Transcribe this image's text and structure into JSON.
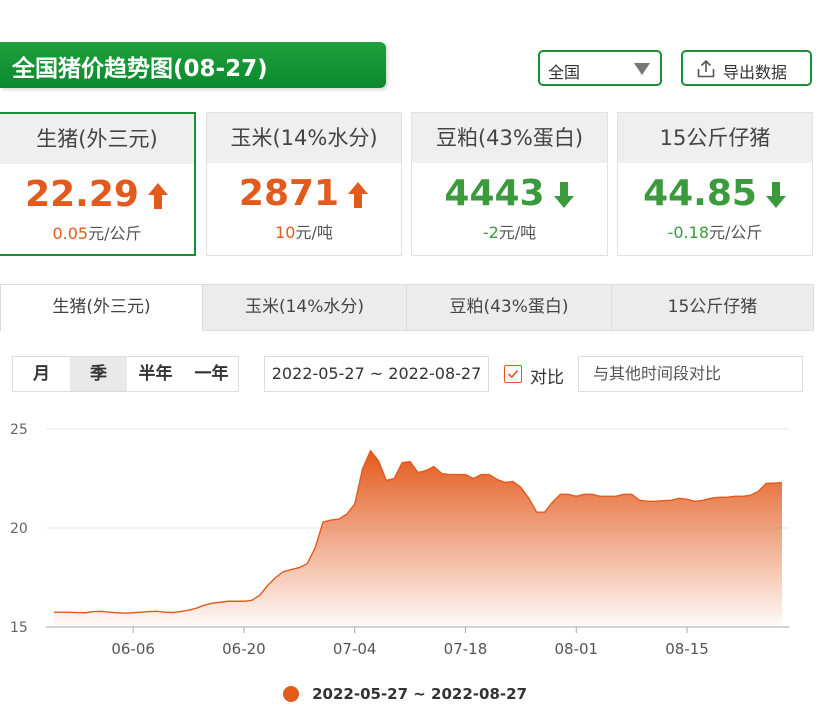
{
  "header": {
    "title": "全国猪价趋势图(08-27)",
    "region": "全国",
    "export_label": "导出数据"
  },
  "cards": [
    {
      "name": "生猪(外三元)",
      "price": "22.29",
      "change_value": "0.05",
      "change_unit": "元/公斤",
      "direction": "up"
    },
    {
      "name": "玉米(14%水分)",
      "price": "2871",
      "change_value": "10",
      "change_unit": "元/吨",
      "direction": "up"
    },
    {
      "name": "豆粕(43%蛋白)",
      "price": "4443",
      "change_value": "-2",
      "change_unit": "元/吨",
      "direction": "down"
    },
    {
      "name": "15公斤仔猪",
      "price": "44.85",
      "change_value": "-0.18",
      "change_unit": "元/公斤",
      "direction": "down"
    }
  ],
  "tabs": [
    "生猪(外三元)",
    "玉米(14%水分)",
    "豆粕(43%蛋白)",
    "15公斤仔猪"
  ],
  "ranges": [
    "月",
    "季",
    "半年",
    "一年"
  ],
  "date_range": "2022-05-27 ~ 2022-08-27",
  "compare": {
    "label": "对比",
    "placeholder": "与其他时间段对比"
  },
  "colors": {
    "brand_green": "#1b8f36",
    "up": "#e35a1d",
    "down": "#3a9a3c",
    "series": "#e35a1d"
  },
  "chart_data": {
    "type": "area",
    "title": "",
    "xlabel": "",
    "ylabel": "",
    "ylim": [
      15,
      25
    ],
    "yticks": [
      15,
      20,
      25
    ],
    "xtick_labels": [
      "06-06",
      "06-20",
      "07-04",
      "07-18",
      "08-01",
      "08-15"
    ],
    "grid": "horizontal",
    "legend_position": "bottom-center",
    "series": [
      {
        "name": "2022-05-27 ~ 2022-08-27",
        "x": [
          "05-27",
          "05-28",
          "05-29",
          "05-30",
          "05-31",
          "06-01",
          "06-02",
          "06-03",
          "06-04",
          "06-05",
          "06-06",
          "06-07",
          "06-08",
          "06-09",
          "06-10",
          "06-11",
          "06-12",
          "06-13",
          "06-14",
          "06-15",
          "06-16",
          "06-17",
          "06-18",
          "06-19",
          "06-20",
          "06-21",
          "06-22",
          "06-23",
          "06-24",
          "06-25",
          "06-26",
          "06-27",
          "06-28",
          "06-29",
          "06-30",
          "07-01",
          "07-02",
          "07-03",
          "07-04",
          "07-05",
          "07-06",
          "07-07",
          "07-08",
          "07-09",
          "07-10",
          "07-11",
          "07-12",
          "07-13",
          "07-14",
          "07-15",
          "07-16",
          "07-17",
          "07-18",
          "07-19",
          "07-20",
          "07-21",
          "07-22",
          "07-23",
          "07-24",
          "07-25",
          "07-26",
          "07-27",
          "07-28",
          "07-29",
          "07-30",
          "07-31",
          "08-01",
          "08-02",
          "08-03",
          "08-04",
          "08-05",
          "08-06",
          "08-07",
          "08-08",
          "08-09",
          "08-10",
          "08-11",
          "08-12",
          "08-13",
          "08-14",
          "08-15",
          "08-16",
          "08-17",
          "08-18",
          "08-19",
          "08-20",
          "08-21",
          "08-22",
          "08-23",
          "08-24",
          "08-25",
          "08-26",
          "08-27"
        ],
        "values": [
          15.75,
          15.75,
          15.74,
          15.73,
          15.72,
          15.78,
          15.79,
          15.75,
          15.72,
          15.7,
          15.72,
          15.75,
          15.78,
          15.79,
          15.75,
          15.73,
          15.78,
          15.85,
          15.95,
          16.1,
          16.2,
          16.25,
          16.3,
          16.3,
          16.3,
          16.35,
          16.6,
          17.1,
          17.5,
          17.8,
          17.9,
          18.0,
          18.2,
          19.0,
          20.3,
          20.4,
          20.45,
          20.7,
          21.2,
          23.0,
          23.9,
          23.4,
          22.4,
          22.5,
          23.3,
          23.35,
          22.8,
          22.9,
          23.1,
          22.75,
          22.7,
          22.7,
          22.7,
          22.5,
          22.7,
          22.7,
          22.45,
          22.3,
          22.35,
          22.05,
          21.5,
          20.8,
          20.8,
          21.3,
          21.7,
          21.7,
          21.6,
          21.7,
          21.7,
          21.6,
          21.6,
          21.6,
          21.7,
          21.7,
          21.4,
          21.35,
          21.35,
          21.38,
          21.4,
          21.5,
          21.45,
          21.35,
          21.4,
          21.5,
          21.55,
          21.55,
          21.6,
          21.6,
          21.65,
          21.85,
          22.25,
          22.27,
          22.29
        ]
      }
    ]
  }
}
